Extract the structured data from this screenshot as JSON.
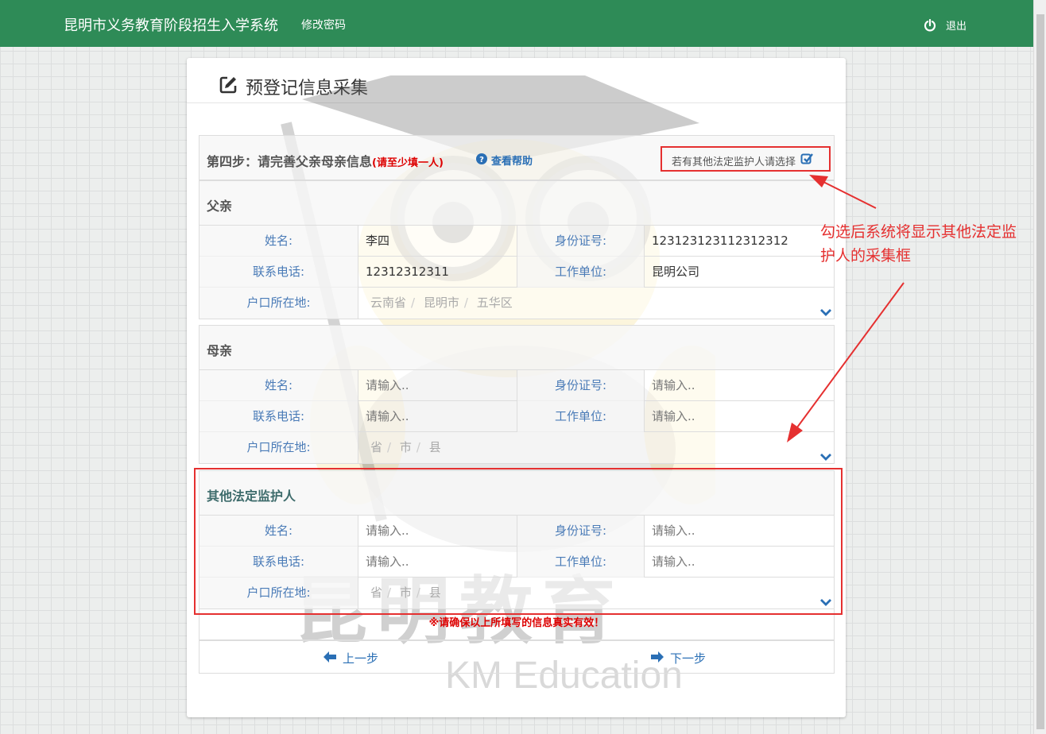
{
  "topbar": {
    "brand": "昆明市义务教育阶段招生入学系统",
    "change_password": "修改密码",
    "logout": "退出"
  },
  "page": {
    "title": "预登记信息采集"
  },
  "step": {
    "title": "第四步：请完善父亲母亲信息",
    "required_note": "(请至少填一人)",
    "help": "查看帮助",
    "other_guardian_toggle": "若有其他法定监护人请选择"
  },
  "father": {
    "heading": "父亲",
    "name_label": "姓名:",
    "name_value": "李四",
    "id_label": "身份证号:",
    "id_value": "123123123112312312",
    "phone_label": "联系电话:",
    "phone_value": "12312312311",
    "work_label": "工作单位:",
    "work_value": "昆明公司",
    "hukou_label": "户口所在地:",
    "province": "云南省",
    "city": "昆明市",
    "county": "五华区"
  },
  "mother": {
    "heading": "母亲",
    "name_label": "姓名:",
    "name_placeholder": "请输入..",
    "id_label": "身份证号:",
    "id_placeholder": "请输入..",
    "phone_label": "联系电话:",
    "phone_placeholder": "请输入..",
    "work_label": "工作单位:",
    "work_placeholder": "请输入..",
    "hukou_label": "户口所在地:",
    "province": "省",
    "city": "市",
    "county": "县"
  },
  "guardian": {
    "heading": "其他法定监护人",
    "name_label": "姓名:",
    "name_placeholder": "请输入..",
    "id_label": "身份证号:",
    "id_placeholder": "请输入..",
    "phone_label": "联系电话:",
    "phone_placeholder": "请输入..",
    "work_label": "工作单位:",
    "work_placeholder": "请输入..",
    "hukou_label": "户口所在地:",
    "province": "省",
    "city": "市",
    "county": "县"
  },
  "notice": "※请确保以上所填写的信息真实有效！",
  "nav": {
    "prev": "上一步",
    "next": "下一步"
  },
  "annotation": "勾选后系统将显示其他法定监护人的采集框",
  "watermark": {
    "cn": "昆明教育",
    "en": "KM Education"
  },
  "colors": {
    "topbar": "#2e8b57",
    "accent": "#2a6fb5",
    "warn": "#e53030"
  }
}
